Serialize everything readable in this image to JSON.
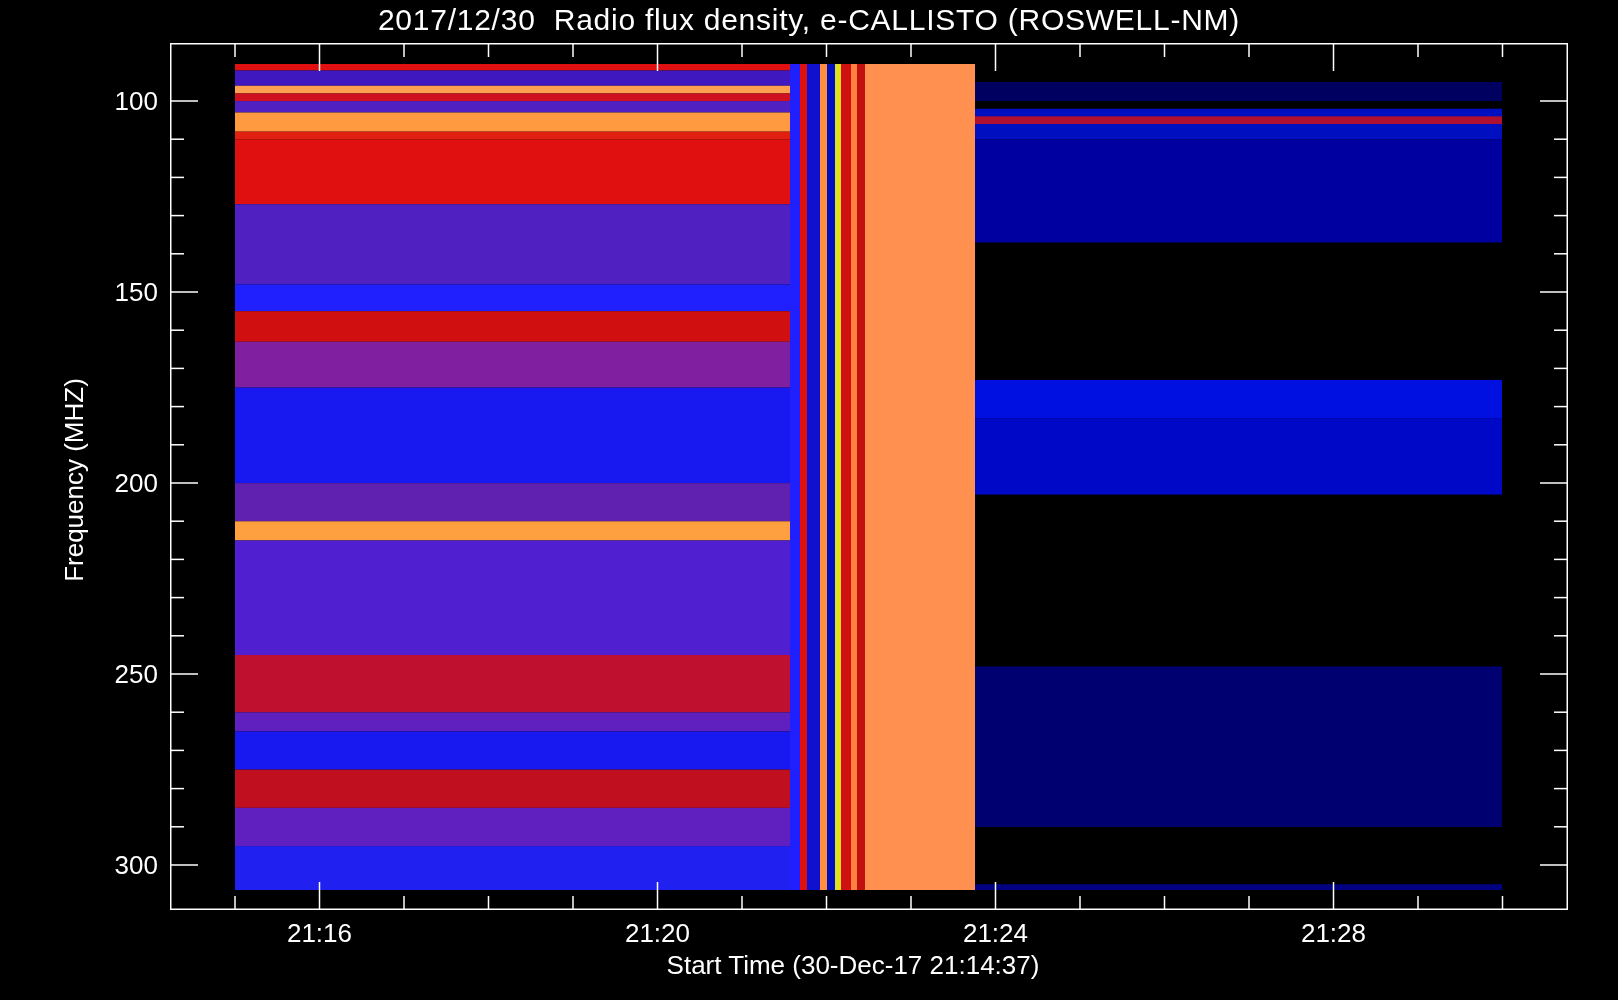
{
  "title": "2017/12/30  Radio flux density, e-CALLISTO (ROSWELL-NM)",
  "y_axis": {
    "label": "Frequency (MHZ)",
    "ticks": [
      "100",
      "150",
      "200",
      "250",
      "300"
    ]
  },
  "x_axis": {
    "label": "Start Time (30-Dec-17 21:14:37)",
    "ticks": [
      "21:16",
      "21:20",
      "21:24",
      "21:28"
    ]
  }
}
